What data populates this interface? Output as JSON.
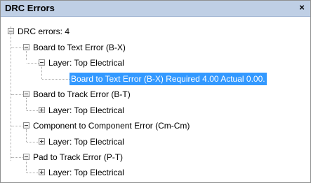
{
  "panel": {
    "title": "DRC Errors",
    "close_glyph": "×"
  },
  "tree": {
    "root": {
      "label": "DRC errors: 4",
      "toggle": "minus"
    },
    "items": [
      {
        "label": "Board to Text Error (B-X)",
        "toggle": "minus",
        "layer": {
          "label": "Layer: Top Electrical",
          "toggle": "minus",
          "detail": {
            "label": "Board to Text Error (B-X) Required 4.00 Actual 0.00.",
            "selected": true
          }
        }
      },
      {
        "label": "Board to Track Error (B-T)",
        "toggle": "minus",
        "layer": {
          "label": "Layer: Top Electrical",
          "toggle": "plus"
        }
      },
      {
        "label": "Component to Component Error (Cm-Cm)",
        "toggle": "minus",
        "layer": {
          "label": "Layer: Top Electrical",
          "toggle": "plus"
        }
      },
      {
        "label": "Pad to Track Error (P-T)",
        "toggle": "minus",
        "layer": {
          "label": "Layer: Top Electrical",
          "toggle": "plus"
        }
      }
    ]
  },
  "colors": {
    "titlebar": "#bfcfe5",
    "selection": "#3399ff",
    "tree_lines": "#a8a8a8",
    "border": "#8e8f8f"
  },
  "icons": {
    "collapse": "minus-box-icon",
    "expand": "plus-box-icon",
    "close": "close-icon"
  }
}
